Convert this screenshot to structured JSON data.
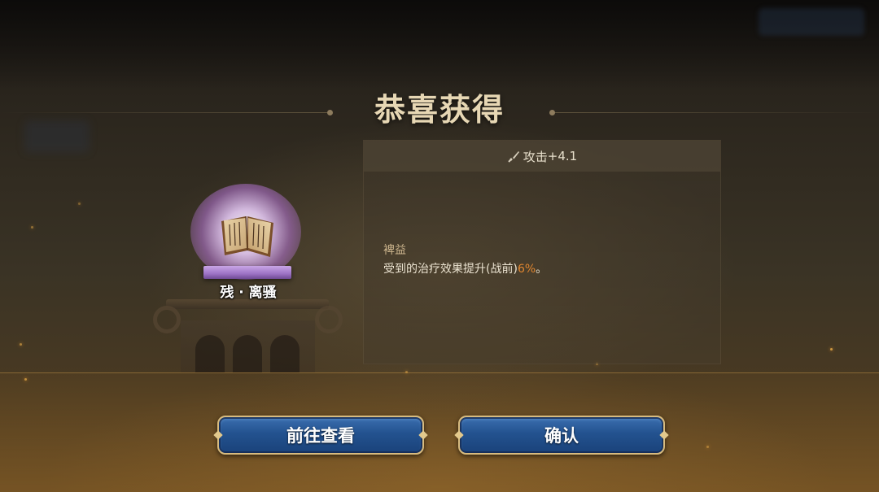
{
  "dialog": {
    "title": "恭喜获得"
  },
  "item": {
    "name": "残 · 离骚",
    "icon": "book-icon",
    "rarity_color": "#9d73c5"
  },
  "stat": {
    "icon": "sword-icon",
    "label": "攻击",
    "value": "+4.1"
  },
  "effect": {
    "name": "裨益",
    "desc_before": "受到的治疗效果提升(战前)",
    "desc_value": "6%",
    "desc_after": "。",
    "highlight_color": "#e1862f"
  },
  "buttons": {
    "goto_label": "前往查看",
    "confirm_label": "确认",
    "color": "#23528f"
  }
}
